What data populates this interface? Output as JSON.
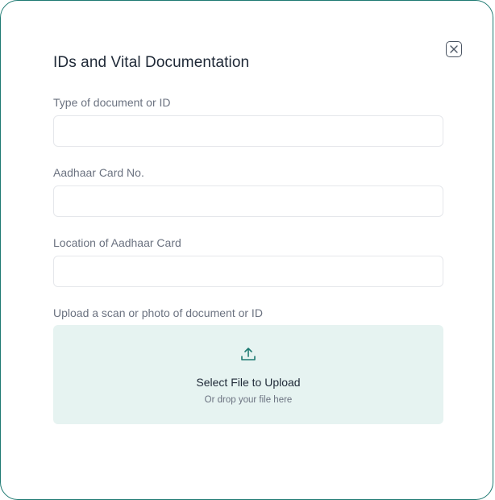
{
  "dialog": {
    "title": "IDs and Vital Documentation",
    "close_icon": "close-icon"
  },
  "fields": [
    {
      "label": "Type of document or ID",
      "value": "",
      "placeholder": ""
    },
    {
      "label": "Aadhaar Card No.",
      "value": "",
      "placeholder": ""
    },
    {
      "label": "Location of Aadhaar Card",
      "value": "",
      "placeholder": ""
    }
  ],
  "upload": {
    "label": "Upload a scan or photo of document or ID",
    "icon": "upload-icon",
    "title": "Select File to Upload",
    "subtitle": "Or drop your file here"
  },
  "colors": {
    "accent": "#1e7a72",
    "upload_background": "#e6f3f1",
    "label_text": "#6b7280",
    "title_text": "#1f2937"
  }
}
